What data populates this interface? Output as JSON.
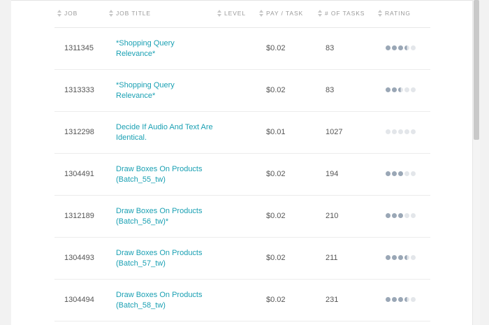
{
  "headers": {
    "job": "JOB",
    "job_title": "JOB TITLE",
    "level": "LEVEL",
    "pay_task": "PAY / TASK",
    "num_tasks": "# OF TASKS",
    "rating": "RATING"
  },
  "colors": {
    "link": "#1aa0b3",
    "rating_filled": "#9aa7b6",
    "rating_empty": "#e3e6ea"
  },
  "rows": [
    {
      "job": "1311345",
      "title": "*Shopping Query Relevance*",
      "pay": "$0.02",
      "tasks": "83",
      "rating": 3.5
    },
    {
      "job": "1313333",
      "title": "*Shopping Query Relevance*",
      "pay": "$0.02",
      "tasks": "83",
      "rating": 2.5
    },
    {
      "job": "1312298",
      "title": "Decide If Audio And Text Are Identical.",
      "pay": "$0.01",
      "tasks": "1027",
      "rating": 0
    },
    {
      "job": "1304491",
      "title": "Draw Boxes On Products (Batch_55_tw)",
      "pay": "$0.02",
      "tasks": "194",
      "rating": 3
    },
    {
      "job": "1312189",
      "title": "Draw Boxes On Products (Batch_56_tw)*",
      "pay": "$0.02",
      "tasks": "210",
      "rating": 3
    },
    {
      "job": "1304493",
      "title": "Draw Boxes On Products (Batch_57_tw)",
      "pay": "$0.02",
      "tasks": "211",
      "rating": 3.5
    },
    {
      "job": "1304494",
      "title": "Draw Boxes On Products (Batch_58_tw)",
      "pay": "$0.02",
      "tasks": "231",
      "rating": 3.5
    }
  ]
}
